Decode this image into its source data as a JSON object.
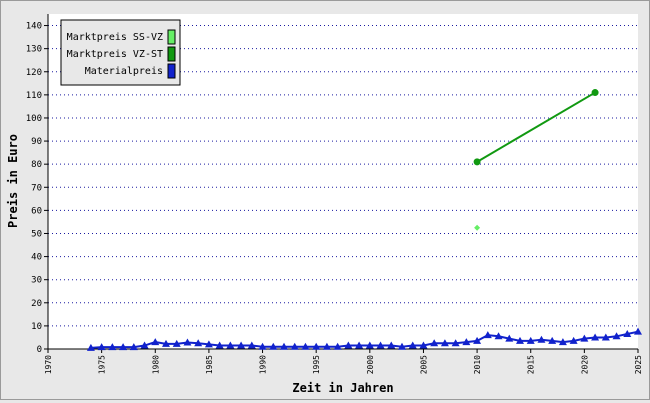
{
  "chart_data": {
    "type": "line",
    "title": "",
    "xlabel": "Zeit in Jahren",
    "ylabel": "Preis in Euro",
    "xlim": [
      1970,
      2025
    ],
    "ylim": [
      0,
      145
    ],
    "x_ticks": [
      1970,
      1975,
      1980,
      1985,
      1990,
      1995,
      2000,
      2005,
      2010,
      2015,
      2020,
      2025
    ],
    "y_ticks": [
      0,
      10,
      20,
      30,
      40,
      50,
      60,
      70,
      80,
      90,
      100,
      110,
      120,
      130,
      140
    ],
    "grid": "horizontal dotted",
    "legend_position": "top-left",
    "series": [
      {
        "name": "Marktpreis SS-VZ",
        "color": "#66ee66",
        "marker": "diamond",
        "line": false,
        "x": [
          2010
        ],
        "y": [
          52.5
        ]
      },
      {
        "name": "Marktpreis VZ-ST",
        "color": "#119911",
        "marker": "circle",
        "line": true,
        "x": [
          2010,
          2021
        ],
        "y": [
          81,
          111
        ]
      },
      {
        "name": "Materialpreis",
        "color": "#1122cc",
        "marker": "triangle",
        "line": true,
        "x": [
          1974,
          1975,
          1976,
          1977,
          1978,
          1979,
          1980,
          1981,
          1982,
          1983,
          1984,
          1985,
          1986,
          1987,
          1988,
          1989,
          1990,
          1991,
          1992,
          1993,
          1994,
          1995,
          1996,
          1997,
          1998,
          1999,
          2000,
          2001,
          2002,
          2003,
          2004,
          2005,
          2006,
          2007,
          2008,
          2009,
          2010,
          2011,
          2012,
          2013,
          2014,
          2015,
          2016,
          2017,
          2018,
          2019,
          2020,
          2021,
          2022,
          2023,
          2024,
          2025
        ],
        "y": [
          0.5,
          0.8,
          0.8,
          0.8,
          0.8,
          1.5,
          3.0,
          2.2,
          2.2,
          2.8,
          2.5,
          2.0,
          1.5,
          1.5,
          1.5,
          1.5,
          1.0,
          1.0,
          1.0,
          1.0,
          1.0,
          1.0,
          1.0,
          1.0,
          1.5,
          1.5,
          1.5,
          1.5,
          1.5,
          1.0,
          1.5,
          1.5,
          2.5,
          2.5,
          2.5,
          3.0,
          3.5,
          6.0,
          5.5,
          4.5,
          3.5,
          3.5,
          4.0,
          3.5,
          3.0,
          3.5,
          4.5,
          5.0,
          5.0,
          5.5,
          6.5,
          7.5
        ]
      }
    ]
  }
}
